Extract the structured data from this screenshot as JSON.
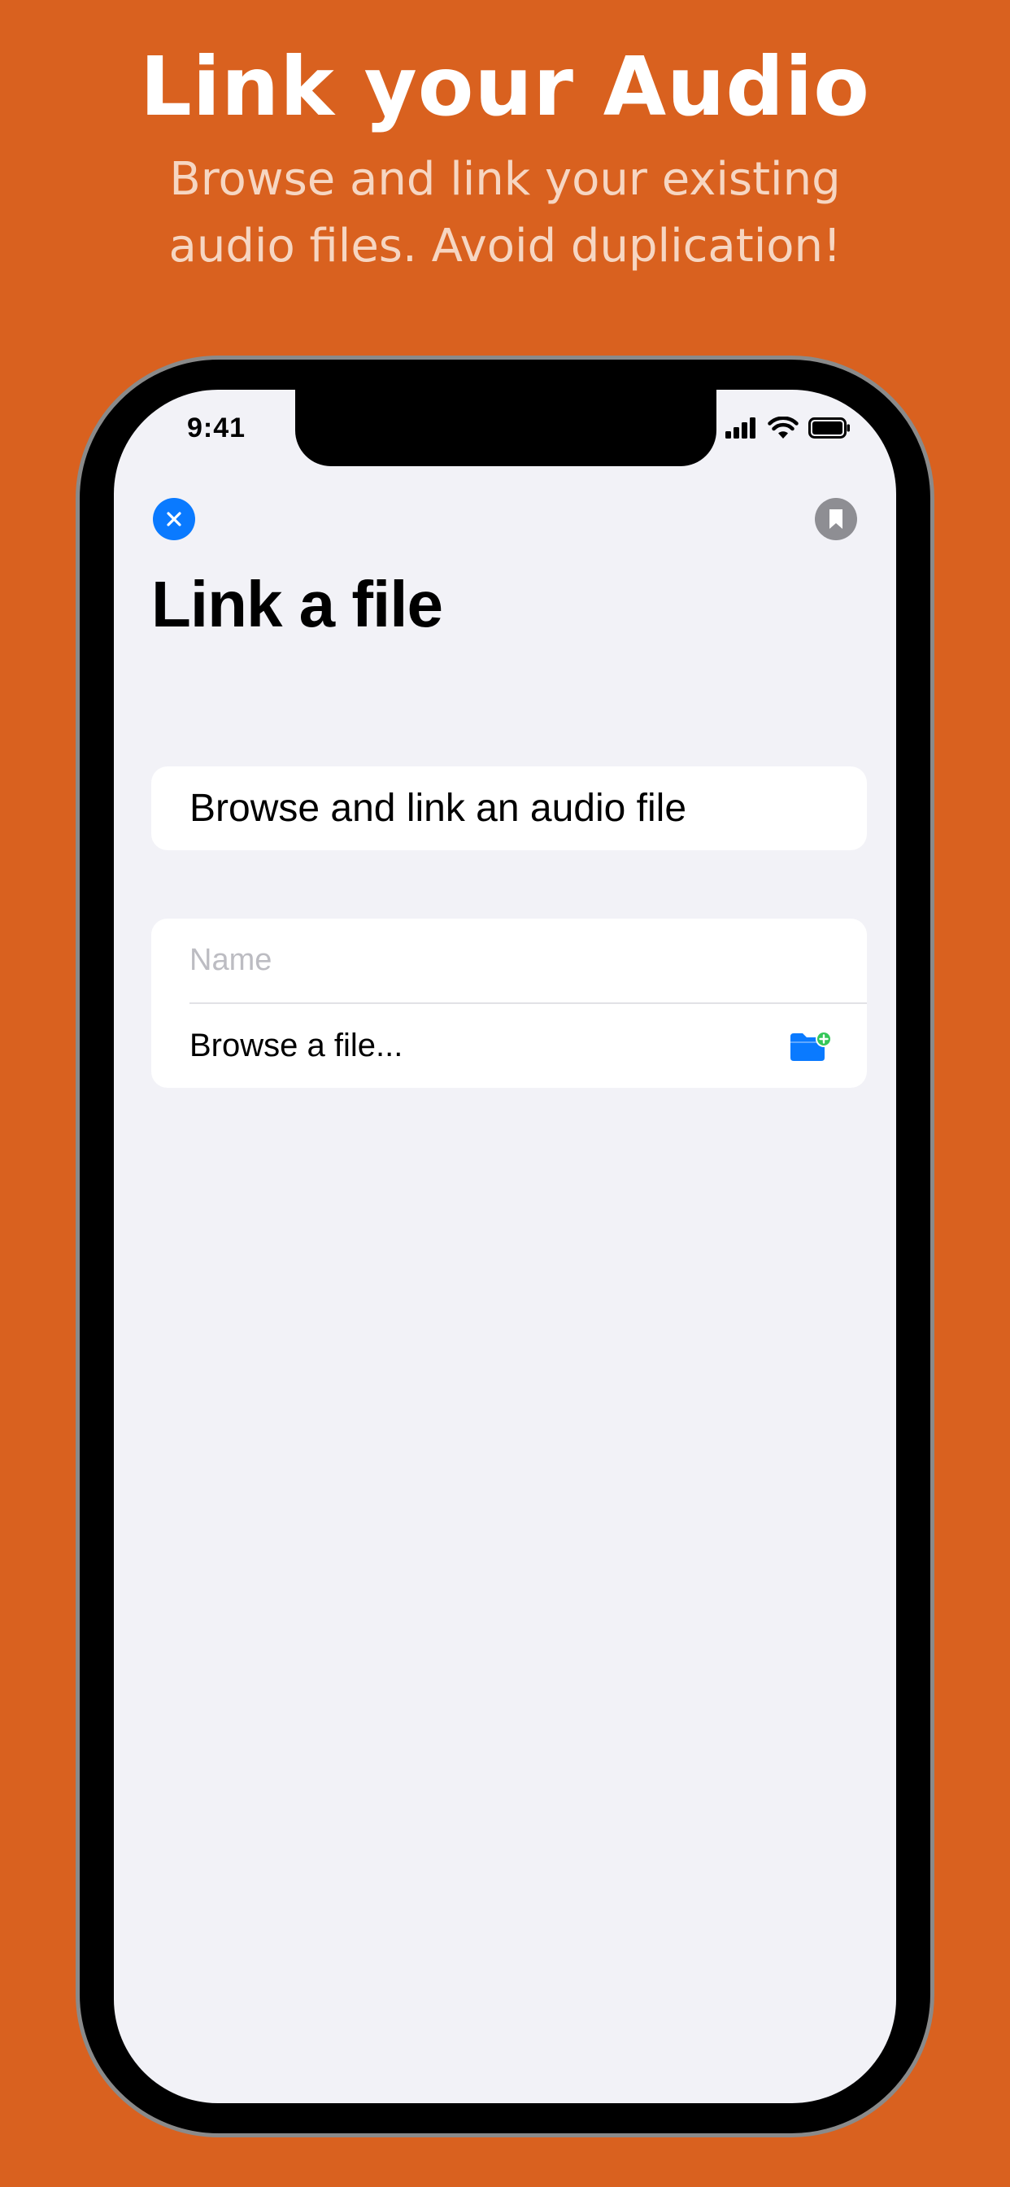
{
  "promo": {
    "title": "Link your Audio",
    "subtitle_line1": "Browse and link your existing",
    "subtitle_line2": "audio files. Avoid duplication!"
  },
  "status_bar": {
    "time": "9:41",
    "icons": [
      "cellular-signal-icon",
      "wifi-icon",
      "battery-icon"
    ]
  },
  "nav": {
    "close_icon": "close-icon",
    "bookmark_icon": "bookmark-icon"
  },
  "page": {
    "title": "Link a file"
  },
  "header_card": {
    "text": "Browse and link an audio file"
  },
  "form": {
    "name_placeholder": "Name",
    "name_value": "",
    "browse_label": "Browse a file...",
    "browse_icon": "folder-add-icon"
  },
  "colors": {
    "background": "#D9611F",
    "accent_blue": "#0A7AFF",
    "gray_button": "#8E8E93",
    "add_badge_green": "#34C759",
    "screen_background": "#F2F2F7"
  }
}
